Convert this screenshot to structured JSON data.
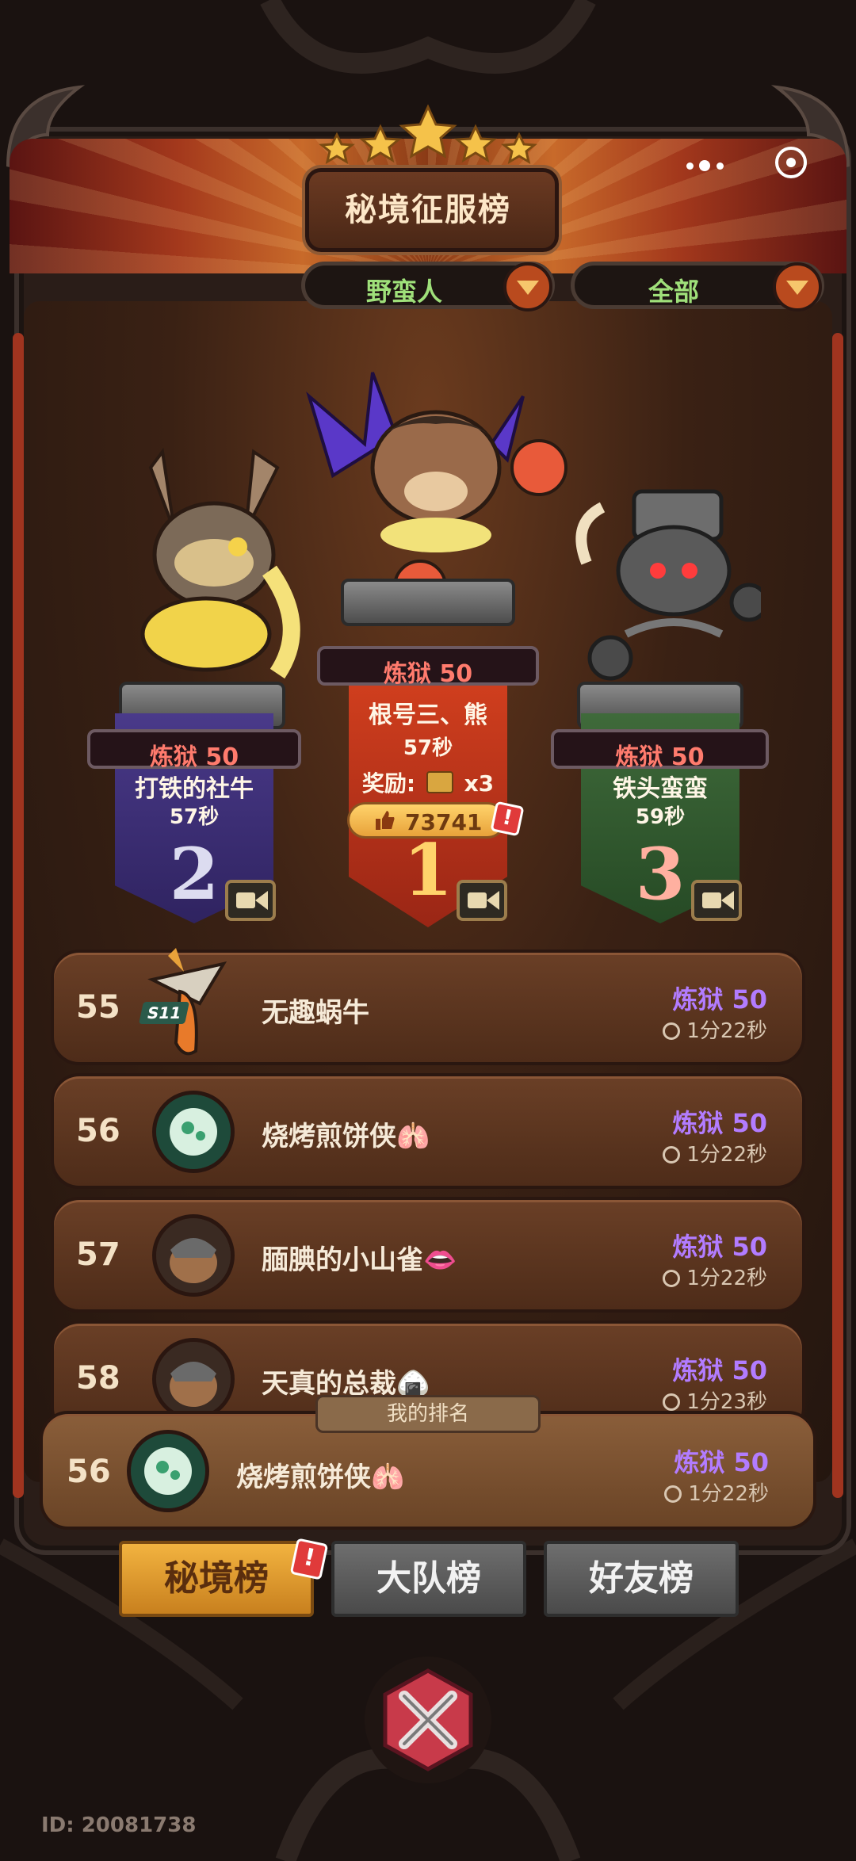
{
  "header": {
    "title": "秘境征服榜",
    "filter_class": "野蛮人",
    "filter_scope": "全部"
  },
  "podium": {
    "first": {
      "rank": "1",
      "level": "炼狱 50",
      "name": "根号三、熊",
      "time": "57秒",
      "reward_label": "奖励:",
      "reward_count": "x3",
      "likes": "73741"
    },
    "second": {
      "rank": "2",
      "level": "炼狱 50",
      "name": "打铁的社牛",
      "time": "57秒"
    },
    "third": {
      "rank": "3",
      "level": "炼狱 50",
      "name": "铁头蛮蛮",
      "time": "59秒"
    }
  },
  "list": [
    {
      "rank": "55",
      "name": "无趣蜗牛",
      "level": "炼狱 50",
      "time": "1分22秒",
      "badge": "S11"
    },
    {
      "rank": "56",
      "name": "烧烤煎饼侠🫁",
      "level": "炼狱 50",
      "time": "1分22秒"
    },
    {
      "rank": "57",
      "name": "腼腆的小山雀👄",
      "level": "炼狱 50",
      "time": "1分22秒"
    },
    {
      "rank": "58",
      "name": "天真的总裁🍙",
      "level": "炼狱 50",
      "time": "1分23秒"
    }
  ],
  "my_rank": {
    "tab_label": "我的排名",
    "rank": "56",
    "name": "烧烤煎饼侠🫁",
    "level": "炼狱 50",
    "time": "1分22秒"
  },
  "tabs": [
    {
      "label": "秘境榜",
      "active": true
    },
    {
      "label": "大队榜",
      "active": false
    },
    {
      "label": "好友榜",
      "active": false
    }
  ],
  "footer": {
    "id_text": "ID: 20081738"
  },
  "badges": {
    "alert": "!"
  },
  "colors": {
    "level_purple": "#b27cff",
    "level_red": "#ff7b6d",
    "filter_green": "#9fe07a",
    "active_tab": "#e8a23a"
  }
}
